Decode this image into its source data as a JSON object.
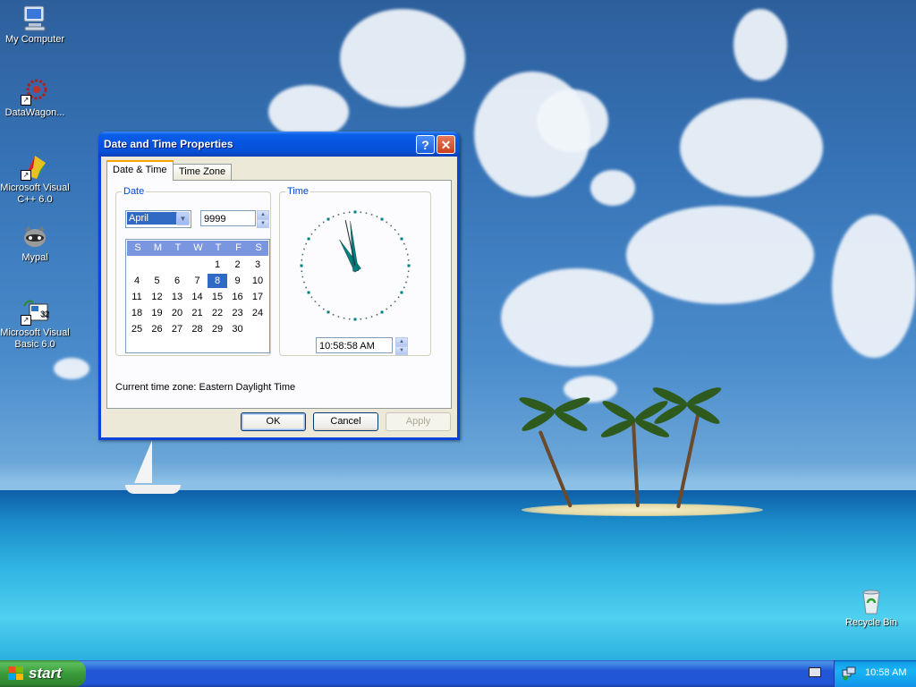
{
  "desktop": {
    "icons": [
      {
        "label": "My Computer"
      },
      {
        "label": "DataWagon..."
      },
      {
        "label": "Microsoft Visual C++ 6.0"
      },
      {
        "label": "Mypal"
      },
      {
        "label": "Microsoft Visual Basic 6.0"
      },
      {
        "label": "Recycle Bin"
      }
    ]
  },
  "dialog": {
    "title": "Date and Time Properties",
    "help_glyph": "?",
    "close_glyph": "✕",
    "tabs": [
      {
        "label": "Date & Time",
        "active": true
      },
      {
        "label": "Time Zone",
        "active": false
      }
    ],
    "date_group": {
      "label": "Date",
      "month": "April",
      "year": "9999",
      "weekdays": [
        "S",
        "M",
        "T",
        "W",
        "T",
        "F",
        "S"
      ],
      "days": [
        "1",
        "2",
        "3",
        "4",
        "5",
        "6",
        "7",
        "8",
        "9",
        "10",
        "11",
        "12",
        "13",
        "14",
        "15",
        "16",
        "17",
        "18",
        "19",
        "20",
        "21",
        "22",
        "23",
        "24",
        "25",
        "26",
        "27",
        "28",
        "29",
        "30"
      ],
      "first_weekday_index": 4,
      "selected_day": "8"
    },
    "time_group": {
      "label": "Time",
      "time_value": "10:58:58 AM",
      "hour": 10,
      "minute": 58,
      "second": 58
    },
    "timezone_text": "Current time zone:  Eastern Daylight Time",
    "buttons": {
      "ok": "OK",
      "cancel": "Cancel",
      "apply": "Apply"
    }
  },
  "taskbar": {
    "start_label": "start",
    "clock": "10:58 AM"
  },
  "colors": {
    "titlebar": "#0553df",
    "accent_tab": "#f7a200",
    "selection": "#316ac5",
    "group_label": "#0046d5",
    "clock_hands": "#008080"
  }
}
